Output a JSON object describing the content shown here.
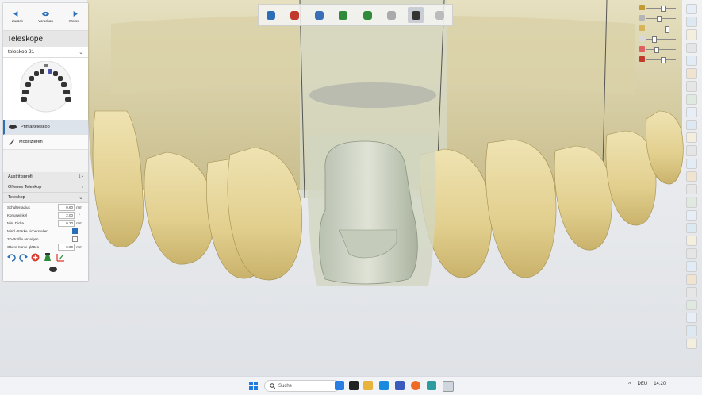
{
  "nav": {
    "back": "Zurück",
    "preview": "Vorschau",
    "next": "Weiter"
  },
  "panel": {
    "title": "Teleskope",
    "dropdown": "teleskop 21",
    "tools": {
      "primary": "Primärteleskop",
      "modify": "Modifizieren"
    },
    "sections": {
      "exit_profile": "Austrittsprofil",
      "exit_profile_badge": "1",
      "open": "Offenes Teleskop",
      "tele": "Teleskop"
    },
    "fields": [
      {
        "label": "Schulterradius",
        "value": "0.60",
        "unit": "mm"
      },
      {
        "label": "Konuswinkel",
        "value": "2.00",
        "unit": "°"
      },
      {
        "label": "Min. Dicke",
        "value": "0.30",
        "unit": "mm"
      }
    ],
    "checks": [
      {
        "label": "Mind.-Stärke sicherstellen",
        "checked": true
      },
      {
        "label": "2D-Profile anzeigen",
        "checked": false
      }
    ],
    "smooth": {
      "label": "Obere Kante glätten",
      "value": "0.00",
      "unit": "mm"
    }
  },
  "toolbar": {
    "items": [
      "pen-icon",
      "tools-icon",
      "brush-icon",
      "tooth-occlusion-icon",
      "gum-icon",
      "ball-icon",
      "telescope-cap-icon",
      "settings-icon"
    ],
    "selected_index": 6
  },
  "right_toolbar": {
    "count": 27
  },
  "slider_levels": [
    0.55,
    0.4,
    0.7,
    0.2,
    0.3,
    0.55
  ],
  "taskbar": {
    "search_placeholder": "Suche",
    "language": "DEU",
    "time": "14:20"
  },
  "colors": {
    "accent": "#2d6fb7",
    "tooth": "#e3d39a",
    "coping": "#c7cfc0"
  }
}
